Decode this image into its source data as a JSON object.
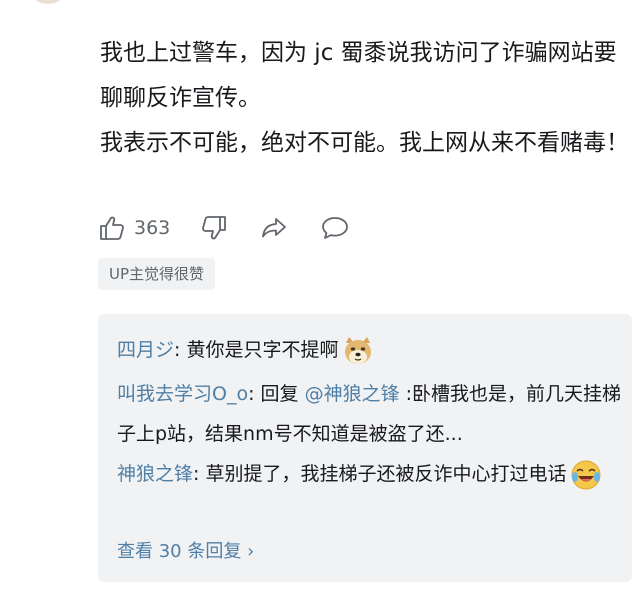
{
  "comment": {
    "paragraphs": [
      "我也上过警车，因为 jc 蜀黍说我访问了诈骗网站要聊聊反诈宣传。",
      "我表示不可能，绝对不可能。我上网从来不看赌毒！"
    ],
    "like_count": "363",
    "up_badge": "UP主觉得很赞"
  },
  "replies": [
    {
      "user": "四月ジ",
      "sep": ": ",
      "text": "黄你是只字不提啊",
      "emoji": "doge-emoji"
    },
    {
      "user": "叫我去学习O_o",
      "sep": ": ",
      "pre": "回复 ",
      "mention": "@神狼之锋",
      "text": " :卧槽我也是，前几天挂梯子上p站，结果nm号不知道是被盗了还..."
    },
    {
      "user": "神狼之锋",
      "sep": ": ",
      "text": "草别提了，我挂梯子还被反诈中心打过电话",
      "emoji": "laugh-cry-emoji"
    }
  ],
  "view_more": "查看 30 条回复 ›",
  "colors": {
    "link": "#4f7fa6",
    "text": "#18191c",
    "muted": "#61666d",
    "reply_bg": "#f1f2f3"
  }
}
